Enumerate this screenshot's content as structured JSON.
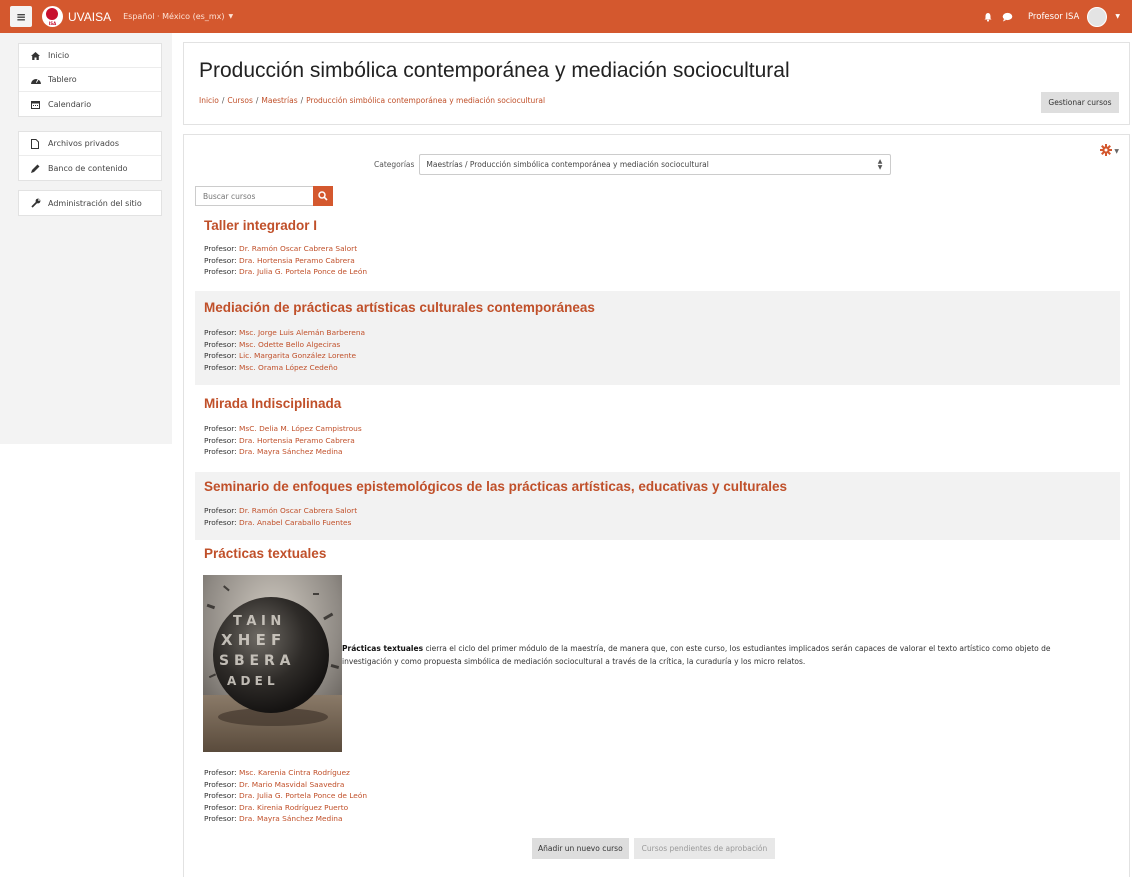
{
  "navbar": {
    "brand_name": "UVAISA",
    "logo_text": "ISA",
    "language": "Español · México (es_mx)",
    "user_name": "Profesor ISA",
    "bg_color": "#d4582e"
  },
  "sidebar": {
    "items": [
      {
        "label": "Inicio",
        "icon": "home-icon"
      },
      {
        "label": "Tablero",
        "icon": "dashboard-icon"
      },
      {
        "label": "Calendario",
        "icon": "calendar-icon"
      },
      {
        "label": "Archivos privados",
        "icon": "file-icon"
      },
      {
        "label": "Banco de contenido",
        "icon": "pen-icon"
      },
      {
        "label": "Administración del sitio",
        "icon": "wrench-icon"
      }
    ]
  },
  "header": {
    "title": "Producción simbólica contemporánea y mediación sociocultural",
    "breadcrumb": [
      "Inicio",
      "Cursos",
      "Maestrías",
      "Producción simbólica contemporánea y mediación sociocultural"
    ],
    "manage_button": "Gestionar cursos"
  },
  "main": {
    "category_label": "Categorías",
    "category_value": "Maestrías / Producción simbólica contemporánea y mediación sociocultural",
    "search_placeholder": "Buscar cursos",
    "teacher_prefix": "Profesor:",
    "courses": [
      {
        "title": "Taller integrador I",
        "teachers": [
          "Dr. Ramón Oscar Cabrera Salort",
          "Dra. Hortensia Peramo Cabrera",
          "Dra. Julia G. Portela Ponce de León"
        ]
      },
      {
        "title": "Mediación de prácticas artísticas culturales contemporáneas",
        "teachers": [
          "Msc. Jorge Luis Alemán Barberena",
          "Msc. Odette Bello Algeciras",
          "Lic. Margarita González Lorente",
          "Msc. Orama López Cedeño"
        ]
      },
      {
        "title": "Mirada Indisciplinada",
        "teachers": [
          "MsC. Delia M. López Campistrous",
          "Dra. Hortensia Peramo Cabrera",
          "Dra. Mayra Sánchez Medina"
        ]
      },
      {
        "title": "Seminario de enfoques epistemológicos de las prácticas artísticas, educativas y culturales",
        "teachers": [
          "Dr. Ramón Oscar Cabrera Salort",
          "Dra. Anabel Caraballo Fuentes"
        ]
      },
      {
        "title": "Prácticas textuales",
        "summary_bold": "Prácticas textuales",
        "summary": " cierra el ciclo del primer módulo de la maestría, de manera que, con este curso, los estudiantes implicados serán capaces de valorar el texto artístico como objeto de investigación y como propuesta simbólica de mediación sociocultural a través de la crítica, la curaduría y los micro relatos.",
        "teachers": [
          "Msc. Karenia Cintra Rodríguez",
          "Dr. Mario Masvidal Saavedra",
          "Dra. Julia G. Portela Ponce de León",
          "Dra. Kirenia Rodríguez Puerto",
          "Dra. Mayra Sánchez Medina"
        ]
      }
    ],
    "add_course_button": "Añadir un nuevo curso",
    "pending_button": "Cursos pendientes de aprobación"
  }
}
